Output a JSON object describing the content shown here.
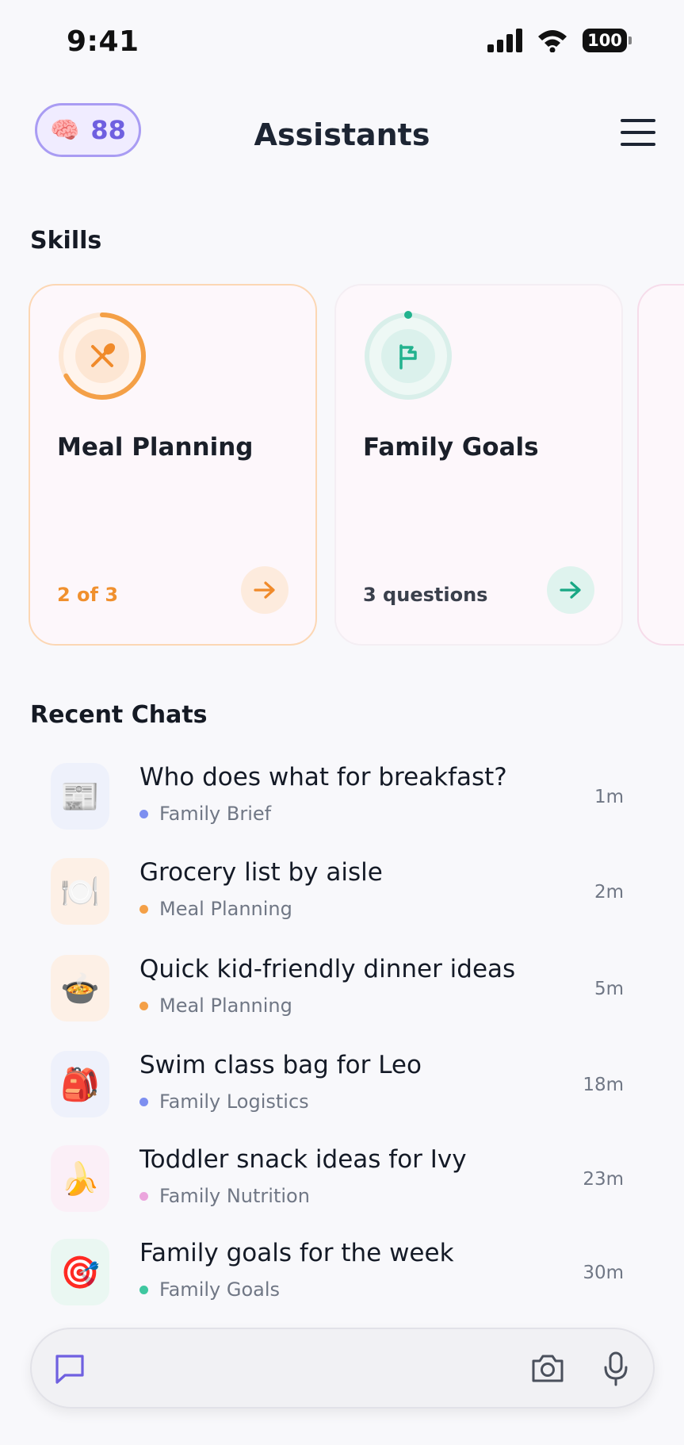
{
  "status": {
    "time": "9:41",
    "battery": "100"
  },
  "header": {
    "points_value": "88",
    "title": "Assistants"
  },
  "skills": {
    "title": "Skills",
    "cards": [
      {
        "name": "Meal Planning",
        "meta": "2 of 3",
        "progress": 0.67,
        "accent": "#f4a047"
      },
      {
        "name": "Family Goals",
        "meta": "3 questions",
        "progress": 0.0,
        "accent": "#2bb895"
      }
    ]
  },
  "recent": {
    "title": "Recent Chats",
    "items": [
      {
        "title": "Who does what for breakfast?",
        "category": "Family Brief",
        "time": "1m",
        "icon": "newspaper-icon",
        "dot": "#7d8ff0"
      },
      {
        "title": "Grocery list by aisle",
        "category": "Meal Planning",
        "time": "2m",
        "icon": "plate-cutlery-icon",
        "dot": "#f4a047"
      },
      {
        "title": "Quick kid-friendly dinner ideas",
        "category": "Meal Planning",
        "time": "5m",
        "icon": "cooking-pot-icon",
        "dot": "#f4a047"
      },
      {
        "title": "Swim class bag for Leo",
        "category": "Family Logistics",
        "time": "18m",
        "icon": "backpack-icon",
        "dot": "#7d8ff0"
      },
      {
        "title": "Toddler snack ideas for Ivy",
        "category": "Family Nutrition",
        "time": "23m",
        "icon": "fruit-bowl-icon",
        "dot": "#eba5dd"
      },
      {
        "title": "Family goals for the week",
        "category": "Family Goals",
        "time": "30m",
        "icon": "target-icon",
        "dot": "#3fc7a0"
      }
    ]
  }
}
